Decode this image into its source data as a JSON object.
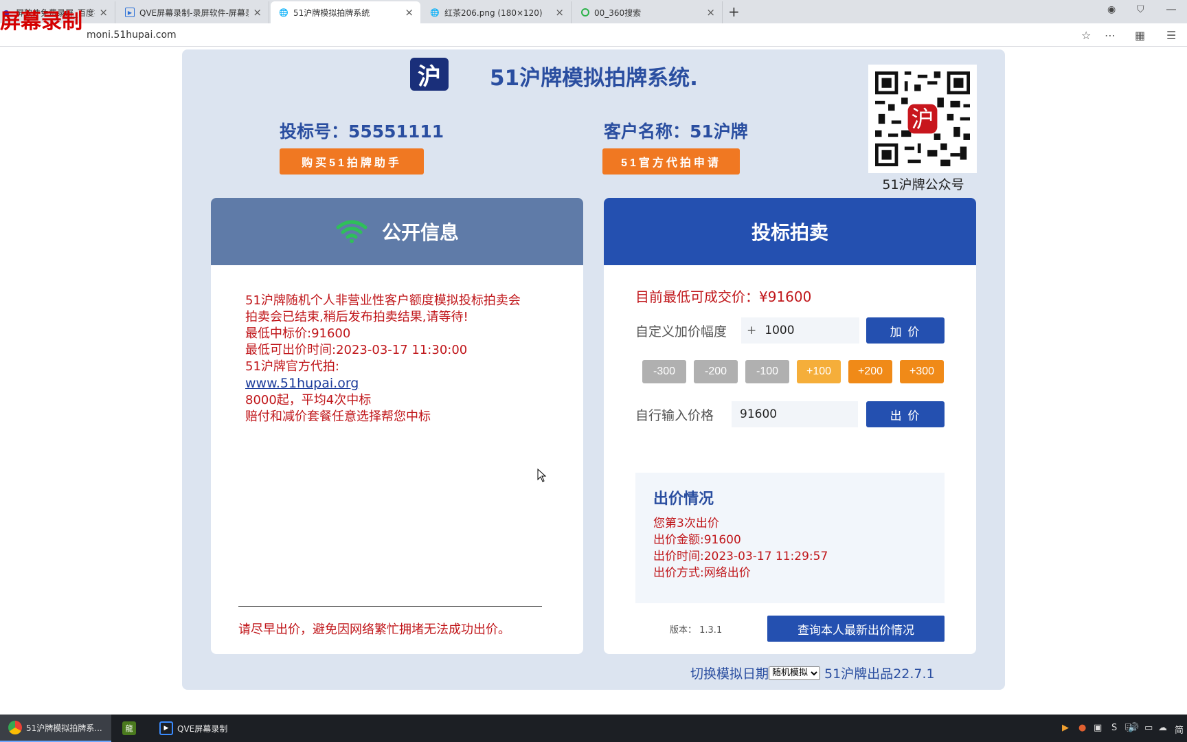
{
  "browser": {
    "tabs": [
      {
        "label": "屏软件免费录屏_百度搜索",
        "icon": "baidu-icon"
      },
      {
        "label": "QVE屏幕录制-录屏软件-屏幕录",
        "icon": "qve-icon"
      },
      {
        "label": "51沪牌模拟拍牌系统",
        "icon": "globe-icon"
      },
      {
        "label": "红茶206.png (180×120)",
        "icon": "globe-icon"
      },
      {
        "label": "00_360搜索",
        "icon": "360-icon"
      }
    ],
    "url": "moni.51hupai.com",
    "watermark": "屏幕录制"
  },
  "header": {
    "logo_char": "沪",
    "title": "51沪牌模拟拍牌系统.",
    "bid_number": "投标号：55551111",
    "customer_name": "客户名称：51沪牌",
    "buy_button": "购买51拍牌助手",
    "apply_button": "51官方代拍申请",
    "qr_label": "51沪牌公众号",
    "qr_center": "沪"
  },
  "public_info": {
    "title": "公开信息",
    "lines": [
      "51沪牌随机个人非营业性客户额度模拟投标拍卖会",
      "拍卖会已结束,稍后发布拍卖结果,请等待!",
      "最低中标价:91600",
      "最低可出价时间:2023-03-17 11:30:00",
      "51沪牌官方代拍:"
    ],
    "link": "www.51hupai.org",
    "lines_after": [
      "8000起，平均4次中标",
      "赔付和减价套餐任意选择帮您中标"
    ],
    "hint": "请尽早出价，避免因网络繁忙拥堵无法成功出价。"
  },
  "bidding": {
    "title": "投标拍卖",
    "lowest_price": "目前最低可成交价：¥91600",
    "increment_label": "自定义加价幅度",
    "increment_plus": "+",
    "increment_value": "1000",
    "raise_button": "加 价",
    "steps": [
      "-300",
      "-200",
      "-100",
      "+100",
      "+200",
      "+300"
    ],
    "price_label": "自行输入价格",
    "price_value": "91600",
    "bid_button": "出 价",
    "status_title": "出价情况",
    "status_lines": [
      "您第3次出价",
      "出价金额:91600",
      "出价时间:2023-03-17 11:29:57",
      "出价方式:网络出价"
    ],
    "version": "版本：  1.3.1",
    "query_button": "查询本人最新出价情况"
  },
  "footer": {
    "switch_label": "切换模拟日期",
    "select_value": "随机模拟",
    "brand": "51沪牌出品22.7.1"
  },
  "taskbar": {
    "items": [
      {
        "label": "51沪牌模拟拍牌系..."
      },
      {
        "label": ""
      },
      {
        "label": "QVE屏幕录制"
      }
    ],
    "tray_ime": "简"
  },
  "colors": {
    "title_blue": "#2a4ea0",
    "accent_orange": "#f07822",
    "alert_red": "#c0161a",
    "panel_blue": "#2450b0",
    "panel_grey_blue": "#5f7ba8"
  }
}
